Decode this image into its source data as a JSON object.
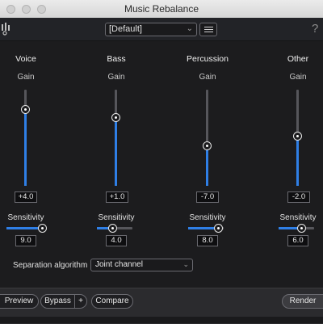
{
  "window": {
    "title": "Music Rebalance"
  },
  "toolbar": {
    "preset_value": "[Default]",
    "preset_chevron": "⌄",
    "help_label": "?",
    "icons": {
      "modules": "modules-icon",
      "menu": "hamburger-menu-icon",
      "help": "help-icon"
    }
  },
  "channels": [
    {
      "name": "Voice",
      "gain_label": "Gain",
      "gain_value": "+4.0",
      "sensitivity_label": "Sensitivity",
      "sensitivity_value": "9.0"
    },
    {
      "name": "Bass",
      "gain_label": "Gain",
      "gain_value": "+1.0",
      "sensitivity_label": "Sensitivity",
      "sensitivity_value": "4.0"
    },
    {
      "name": "Percussion",
      "gain_label": "Gain",
      "gain_value": "-7.0",
      "sensitivity_label": "Sensitivity",
      "sensitivity_value": "8.0"
    },
    {
      "name": "Other",
      "gain_label": "Gain",
      "gain_value": "-2.0",
      "sensitivity_label": "Sensitivity",
      "sensitivity_value": "6.0"
    }
  ],
  "separation": {
    "label": "Separation algorithm",
    "value": "Joint channel",
    "chevron": "⌄"
  },
  "bottom": {
    "preview": "Preview",
    "bypass": "Bypass",
    "plus": "+",
    "compare": "Compare",
    "render": "Render"
  },
  "colors": {
    "accent": "#2f7fe6",
    "background": "#1c1c1e"
  }
}
